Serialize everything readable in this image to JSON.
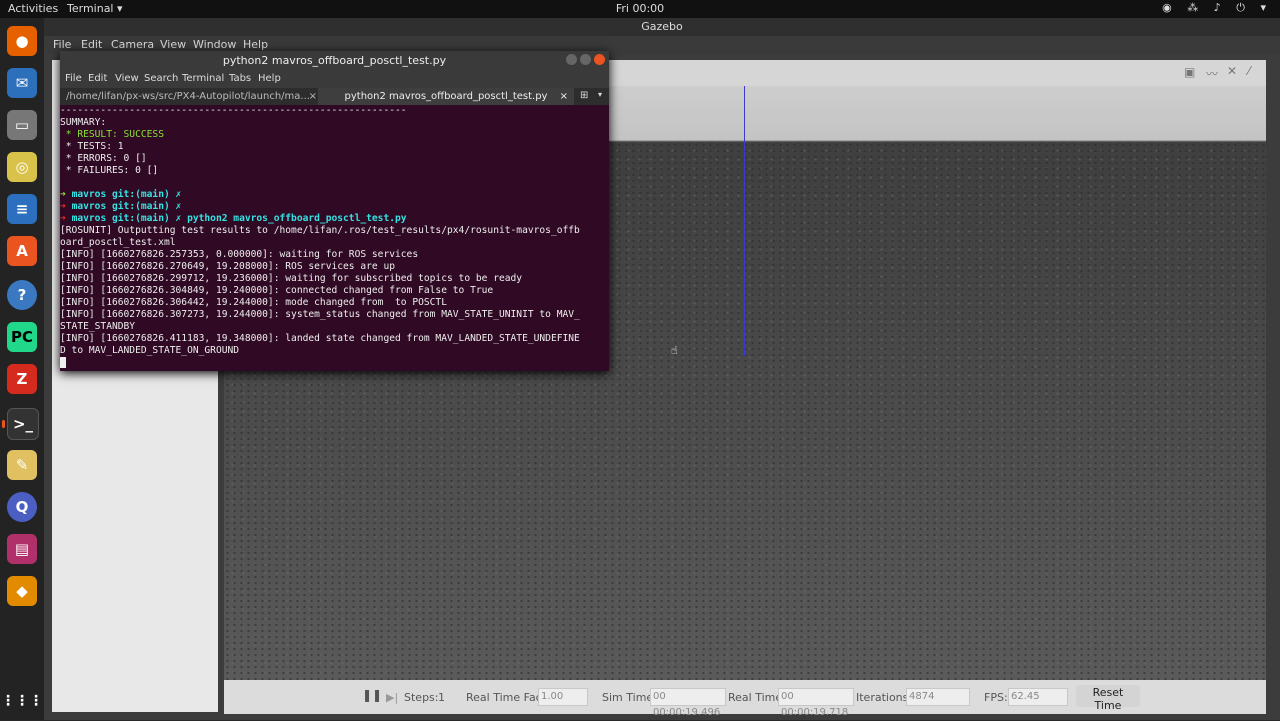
{
  "topbar": {
    "activities": "Activities",
    "app_menu": "Terminal ▾",
    "clock": "Fri 00:00",
    "tray": "◉ ⁂ ♪ ⏻ ▾"
  },
  "dock": {
    "apps_label": "⋮⋮⋮"
  },
  "gazebo": {
    "title": "Gazebo",
    "menu": [
      "File",
      "Edit",
      "Camera",
      "View",
      "Window",
      "Help"
    ],
    "bottom": {
      "steps_label": "Steps:",
      "steps_value": "1",
      "rtf_label": "Real Time Factor:",
      "rtf_value": "1.00",
      "sim_time_label": "Sim Time:",
      "sim_time_value": "00 00:00:19.496",
      "real_time_label": "Real Time:",
      "real_time_value": "00 00:00:19.718",
      "iterations_label": "Iterations:",
      "iterations_value": "4874",
      "fps_label": "FPS:",
      "fps_value": "62.45",
      "reset_label": "Reset Time"
    }
  },
  "terminal": {
    "title": "python2 mavros_offboard_posctl_test.py",
    "menu": [
      "File",
      "Edit",
      "View",
      "Search",
      "Terminal",
      "Tabs",
      "Help"
    ],
    "tabs": [
      {
        "label": "/home/lifan/px-ws/src/PX4-Autopilot/launch/ma..."
      },
      {
        "label": "python2 mavros_offboard_posctl_test.py"
      }
    ],
    "lines": [
      "------------------------------------------------------------",
      "SUMMARY:",
      " * RESULT: SUCCESS",
      " * TESTS: 1",
      " * ERRORS: 0 []",
      " * FAILURES: 0 []",
      "",
      "mavros git:(main) ✗",
      "mavros git:(main) ✗",
      "mavros git:(main) ✗ python2 mavros_offboard_posctl_test.py",
      "[ROSUNIT] Outputting test results to /home/lifan/.ros/test_results/px4/rosunit-mavros_offb",
      "oard_posctl_test.xml",
      "[INFO] [1660276826.257353, 0.000000]: waiting for ROS services",
      "[INFO] [1660276826.270649, 19.208000]: ROS services are up",
      "[INFO] [1660276826.299712, 19.236000]: waiting for subscribed topics to be ready",
      "[INFO] [1660276826.304849, 19.240000]: connected changed from False to True",
      "[INFO] [1660276826.306442, 19.244000]: mode changed from  to POSCTL",
      "[INFO] [1660276826.307273, 19.244000]: system_status changed from MAV_STATE_UNINIT to MAV_",
      "STATE_STANDBY",
      "[INFO] [1660276826.411183, 19.348000]: landed state changed from MAV_LANDED_STATE_UNDEFINE",
      "D to MAV_LANDED_STATE_ON_GROUND"
    ],
    "colors": {
      "bg": "#300a24",
      "prompt": "#34e2e2",
      "arrow_green": "#8ae234",
      "arrow_red": "#ef2929",
      "branch": "#ef2929",
      "success": "#8ae234"
    }
  }
}
